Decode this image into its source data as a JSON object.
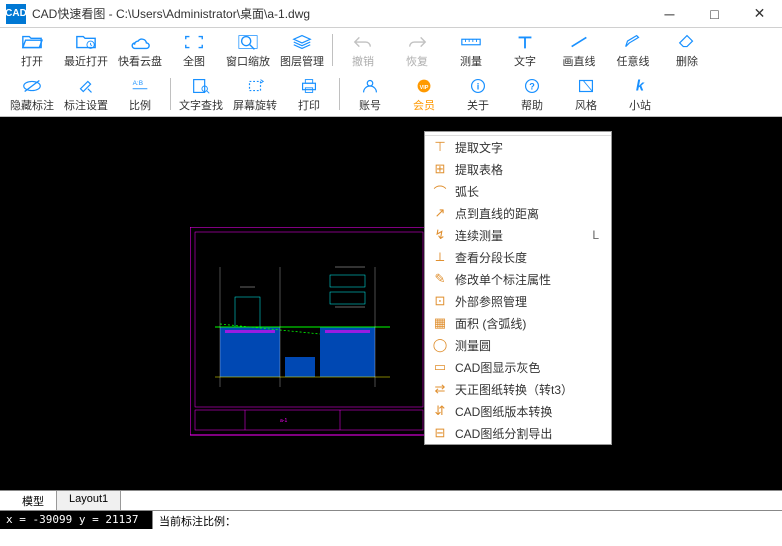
{
  "title": "CAD快速看图 - C:\\Users\\Administrator\\桌面\\a-1.dwg",
  "toolbar": {
    "row1": {
      "open": "打开",
      "recent": "最近打开",
      "cloud": "快看云盘",
      "full": "全图",
      "window": "窗口缩放",
      "layer": "图层管理",
      "undo": "撤销",
      "redo": "恢复",
      "measure": "测量",
      "text": "文字",
      "line": "画直线",
      "anyline": "任意线",
      "delete": "删除"
    },
    "row2": {
      "hide": "隐藏标注",
      "markset": "标注设置",
      "scale": "比例",
      "textsearch": "文字查找",
      "rotate": "屏幕旋转",
      "print": "打印",
      "account": "账号",
      "vip": "会员",
      "about": "关于",
      "help": "帮助",
      "style": "风格",
      "site": "小站"
    }
  },
  "menu": [
    {
      "icon": "⊤",
      "text": "提取文字",
      "sc": ""
    },
    {
      "icon": "⊞",
      "text": "提取表格",
      "sc": ""
    },
    {
      "icon": "⌒",
      "text": "弧长",
      "sc": ""
    },
    {
      "icon": "↗",
      "text": "点到直线的距离",
      "sc": ""
    },
    {
      "icon": "↯",
      "text": "连续测量",
      "sc": "L"
    },
    {
      "icon": "⟂",
      "text": "查看分段长度",
      "sc": ""
    },
    {
      "icon": "✎",
      "text": "修改单个标注属性",
      "sc": ""
    },
    {
      "icon": "⊡",
      "text": "外部参照管理",
      "sc": ""
    },
    {
      "icon": "▦",
      "text": "面积 (含弧线)",
      "sc": ""
    },
    {
      "icon": "◯",
      "text": "测量圆",
      "sc": ""
    },
    {
      "icon": "▭",
      "text": "CAD图显示灰色",
      "sc": ""
    },
    {
      "icon": "⇄",
      "text": "天正图纸转换（转t3）",
      "sc": ""
    },
    {
      "icon": "⇵",
      "text": "CAD图纸版本转换",
      "sc": ""
    },
    {
      "icon": "⊟",
      "text": "CAD图纸分割导出",
      "sc": ""
    }
  ],
  "tabs": {
    "model": "模型",
    "layout": "Layout1"
  },
  "status": {
    "coords": "x = -39099 y = 21137",
    "scale": "当前标注比例："
  }
}
